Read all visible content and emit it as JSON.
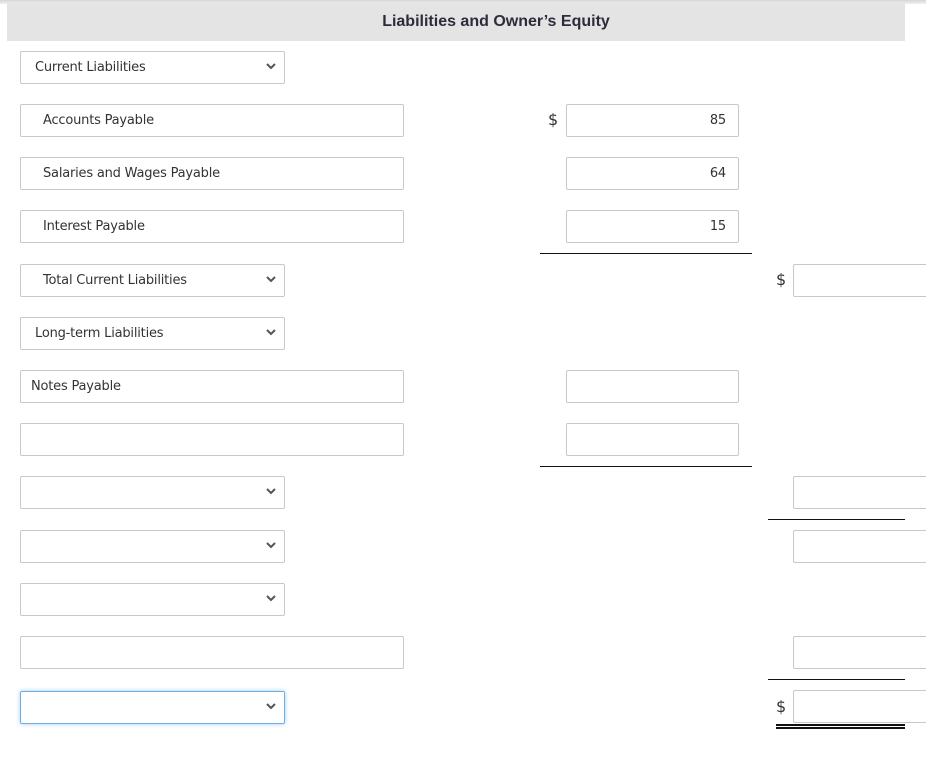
{
  "header": {
    "title": "Liabilities and Owner’s Equity"
  },
  "currency_symbol": "$",
  "rows": [
    {
      "label": "Current Liabilities",
      "type": "select",
      "amount": "",
      "total": ""
    },
    {
      "label": "Accounts Payable",
      "type": "text",
      "amount": "85"
    },
    {
      "label": "Salaries and Wages Payable",
      "type": "text",
      "amount": "64"
    },
    {
      "label": "Interest Payable",
      "type": "text",
      "amount": "15"
    },
    {
      "label": "Total Current Liabilities",
      "type": "select",
      "total": ""
    },
    {
      "label": "Long-term Liabilities",
      "type": "select"
    },
    {
      "label": "Notes Payable",
      "type": "text",
      "amount": ""
    },
    {
      "label": "",
      "type": "text",
      "amount": ""
    },
    {
      "label": "",
      "type": "select",
      "total": ""
    },
    {
      "label": "",
      "type": "select",
      "total": ""
    },
    {
      "label": "",
      "type": "select"
    },
    {
      "label": "",
      "type": "text",
      "total": ""
    },
    {
      "label": "",
      "type": "select",
      "total": "",
      "focused": true
    }
  ]
}
